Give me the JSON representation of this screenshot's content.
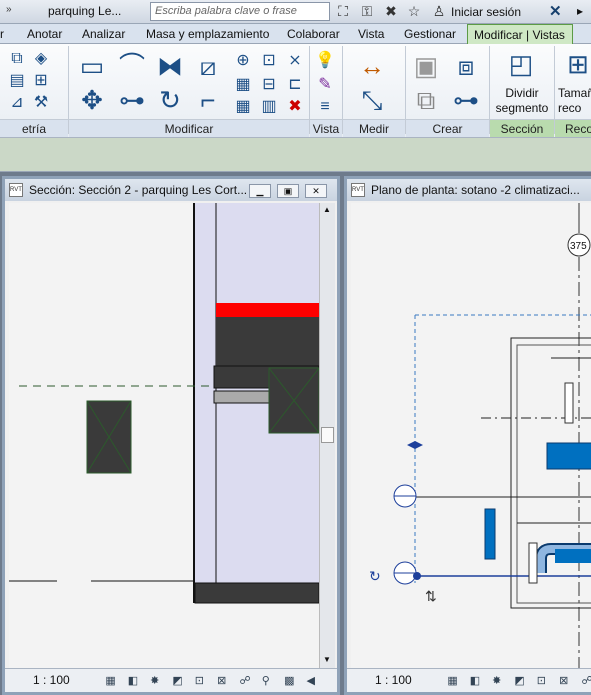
{
  "titlebar": {
    "arrows": "»",
    "doc_title": "parquing Le...",
    "search_placeholder": "Escriba palabra clave o frase",
    "login": "Iniciar sesión"
  },
  "tabs": [
    "r",
    "Anotar",
    "Analizar",
    "Masa y emplazamiento",
    "Colaborar",
    "Vista",
    "Gestionar",
    "Modificar | Vistas"
  ],
  "ribbon_groups": {
    "geometria": "etría",
    "modificar": "Modificar",
    "vista": "Vista",
    "medir": "Medir",
    "crear": "Crear",
    "seccion": "Sección",
    "recortar": "Reco"
  },
  "split_button": {
    "line1": "Dividir",
    "line2": "segmento"
  },
  "size_button": {
    "line1": "Tamañ",
    "line2": "reco"
  },
  "left_window": {
    "title": "Sección: Sección 2 - parquing Les Cort...",
    "scale": "1 : 100"
  },
  "right_window": {
    "title": "Plano de planta: sotano -2 climatizaci...",
    "scale": "1 : 100",
    "grid_tag": "375"
  },
  "colors": {
    "accent_green": "#5c9b45",
    "highlight_red": "#ff0000",
    "duct_blue": "#0070c0",
    "dashed_blue": "#3a78c2"
  }
}
